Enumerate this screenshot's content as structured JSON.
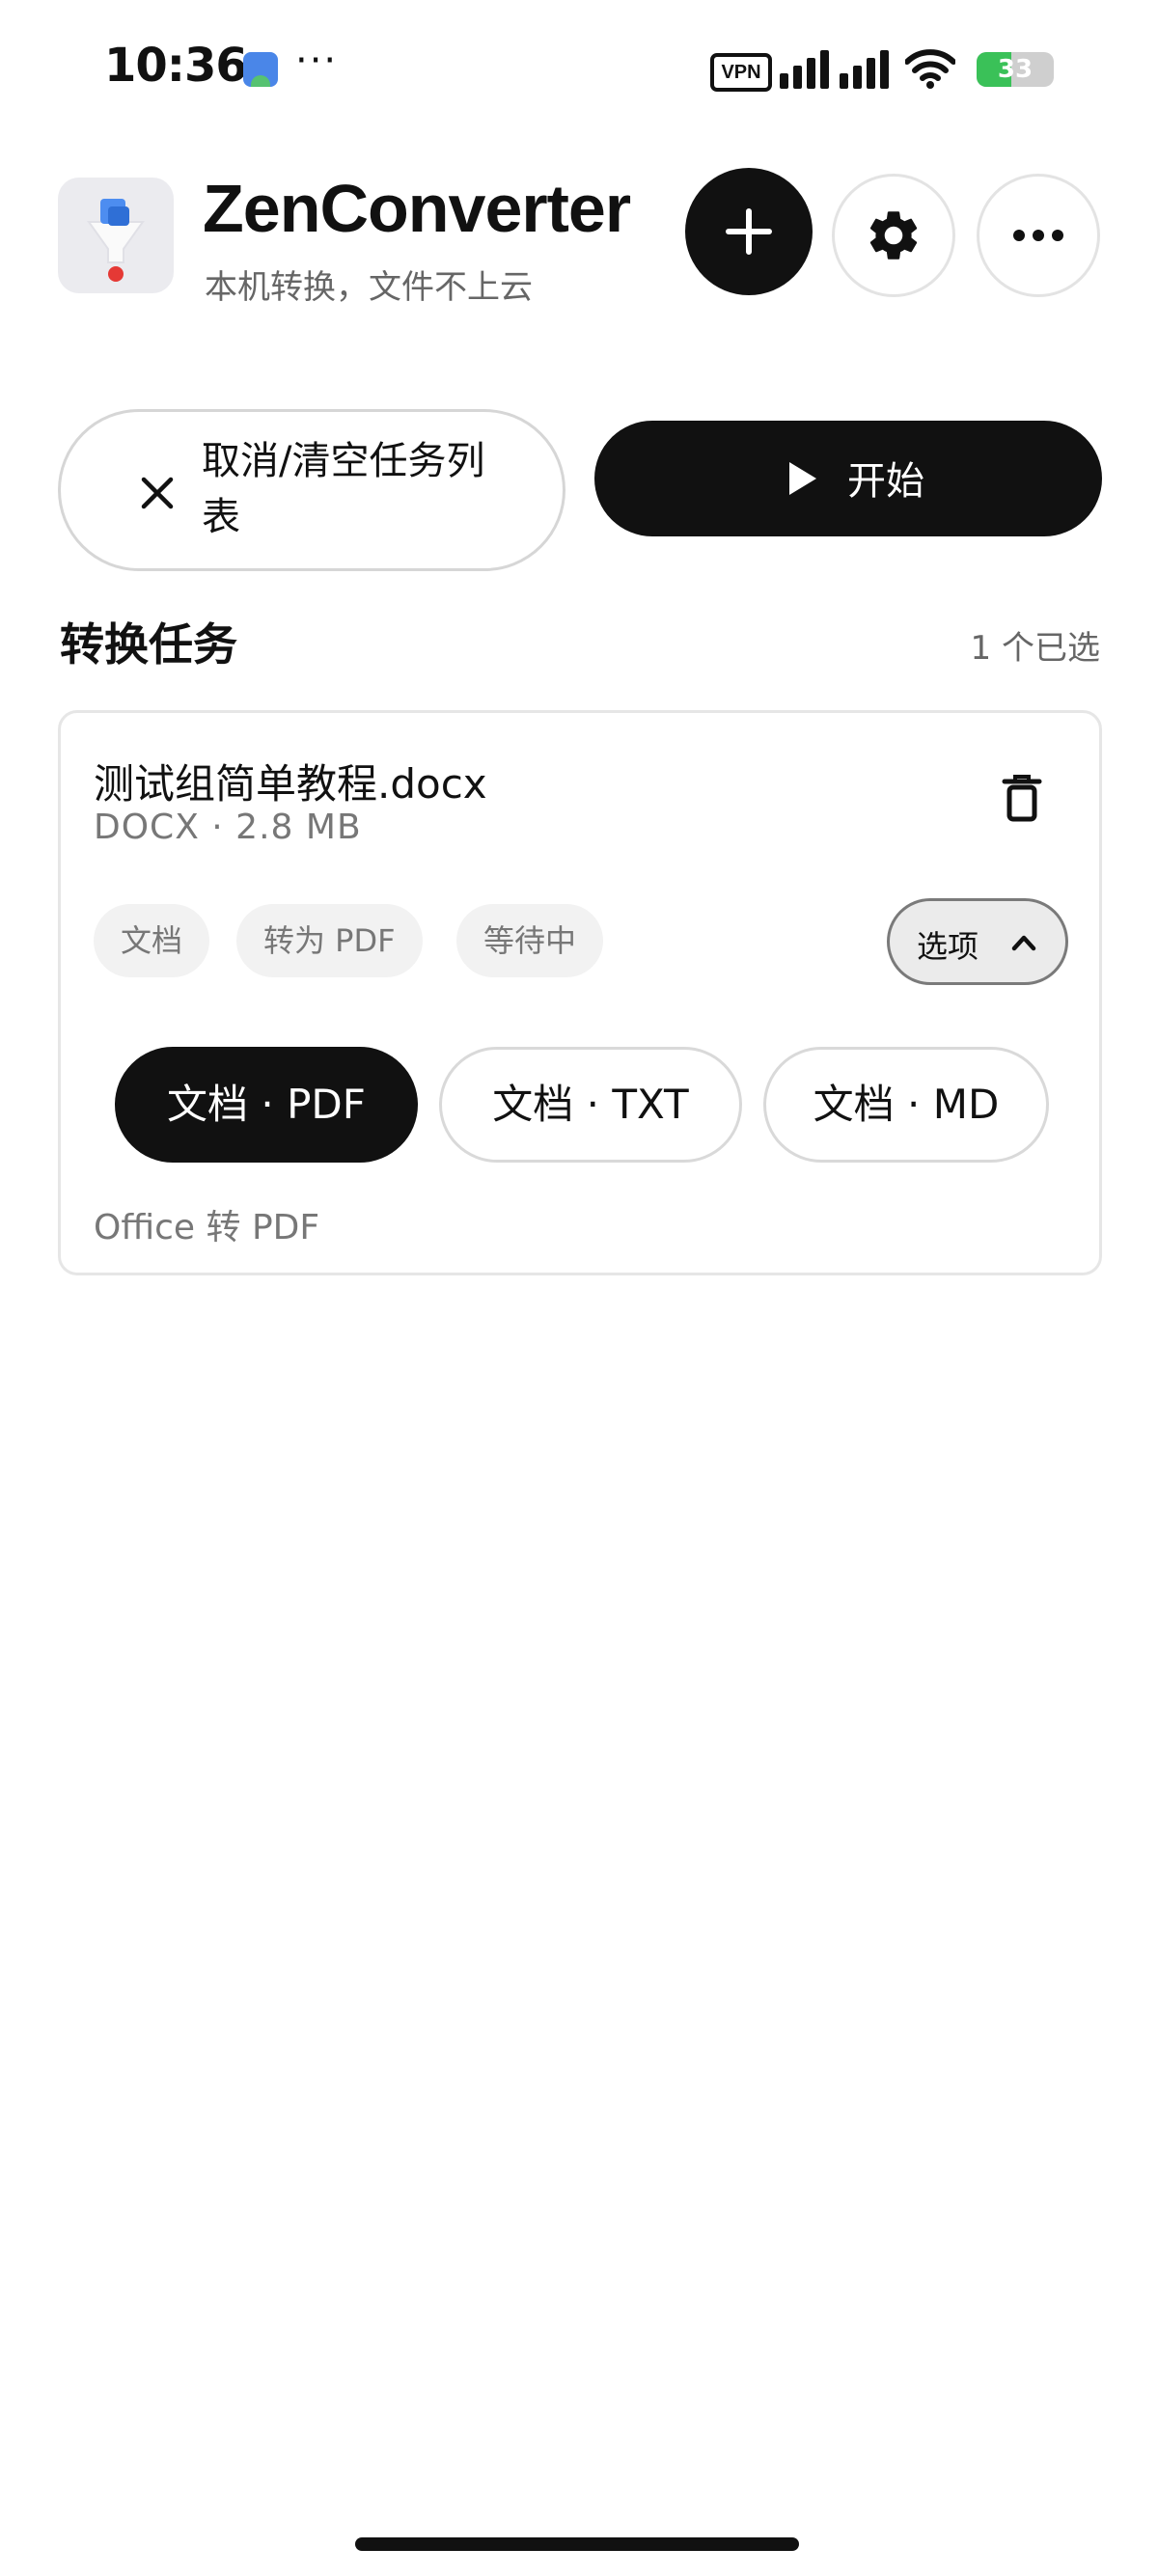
{
  "status_bar": {
    "time": "10:36",
    "more": "···",
    "vpn": "VPN",
    "battery": "33",
    "battery_level": 0.33
  },
  "header": {
    "title": "ZenConverter",
    "subtitle": "本机转换，文件不上云"
  },
  "actions": {
    "cancel_label": "取消/清空任务列表",
    "start_label": "开始"
  },
  "section": {
    "title": "转换任务",
    "selected_count": "1 个已选"
  },
  "task": {
    "file_name": "测试组简单教程.docx",
    "file_meta": "DOCX · 2.8 MB",
    "tags": [
      "文档",
      "转为 PDF",
      "等待中"
    ],
    "options_label": "选项",
    "formats": [
      {
        "label": "文档 · PDF",
        "selected": true
      },
      {
        "label": "文档 · TXT",
        "selected": false
      },
      {
        "label": "文档 · MD",
        "selected": false
      }
    ],
    "description": "Office 转 PDF"
  },
  "colors": {
    "primary": "#111111",
    "battery_green": "#3ac158",
    "muted_text": "#777777"
  },
  "icons": {
    "add": "plus-icon",
    "settings": "gear-icon",
    "more": "more-horizontal-icon",
    "cancel": "close-icon",
    "start": "play-icon",
    "delete": "trash-icon",
    "options": "chevron-up-icon"
  }
}
